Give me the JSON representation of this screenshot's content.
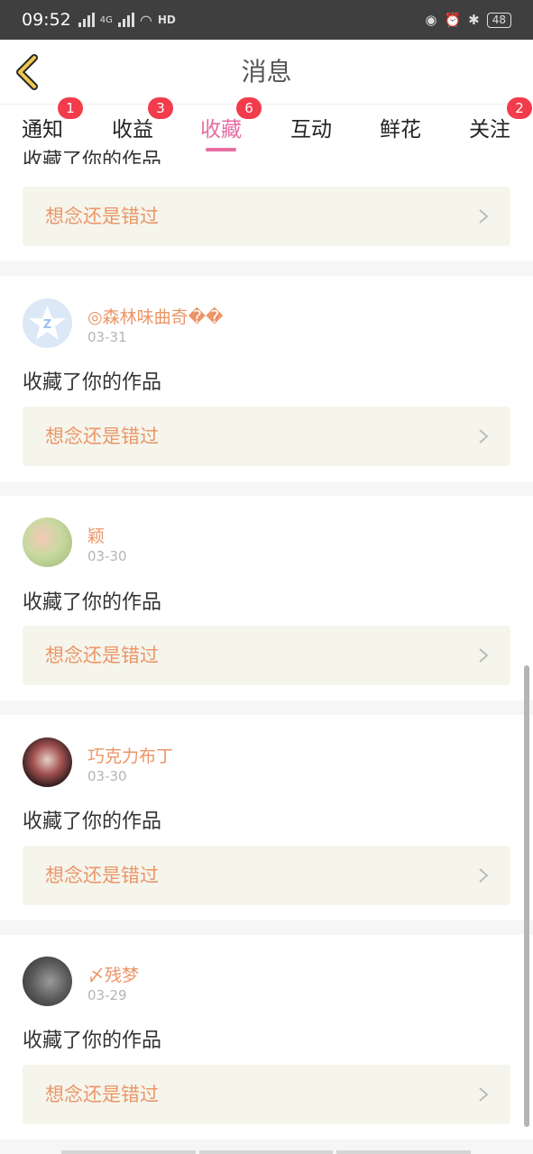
{
  "status_bar": {
    "time": "09:52",
    "network": "4G",
    "hd": "HD",
    "battery": "48"
  },
  "header": {
    "title": "消息"
  },
  "tabs": [
    {
      "label": "通知",
      "badge": "1"
    },
    {
      "label": "收益",
      "badge": "3"
    },
    {
      "label": "收藏",
      "badge": "6",
      "active": true
    },
    {
      "label": "互动"
    },
    {
      "label": "鲜花"
    },
    {
      "label": "关注",
      "badge": "2"
    }
  ],
  "feed": {
    "partial_top_action": "收藏了你的作品",
    "partial_top_card": "想念还是错过",
    "items": [
      {
        "name": "◎森林味曲奇��",
        "date": "03-31",
        "action": "收藏了你的作品",
        "card": "想念还是错过",
        "avatar": "default-avatar"
      },
      {
        "name": "颖",
        "date": "03-30",
        "action": "收藏了你的作品",
        "card": "想念还是错过",
        "avatar": "flower-avatar"
      },
      {
        "name": "巧克力布丁",
        "date": "03-30",
        "action": "收藏了你的作品",
        "card": "想念还是错过",
        "avatar": "girl-avatar"
      },
      {
        "name": "〆残梦",
        "date": "03-29",
        "action": "收藏了你的作品",
        "card": "想念还是错过",
        "avatar": "hand-avatar"
      }
    ]
  },
  "colors": {
    "accent": "#e56da1",
    "username": "#ec9567",
    "badge": "#f23c4c",
    "card_bg": "#f5f5ec",
    "back_arrow": "#f2c94c"
  }
}
